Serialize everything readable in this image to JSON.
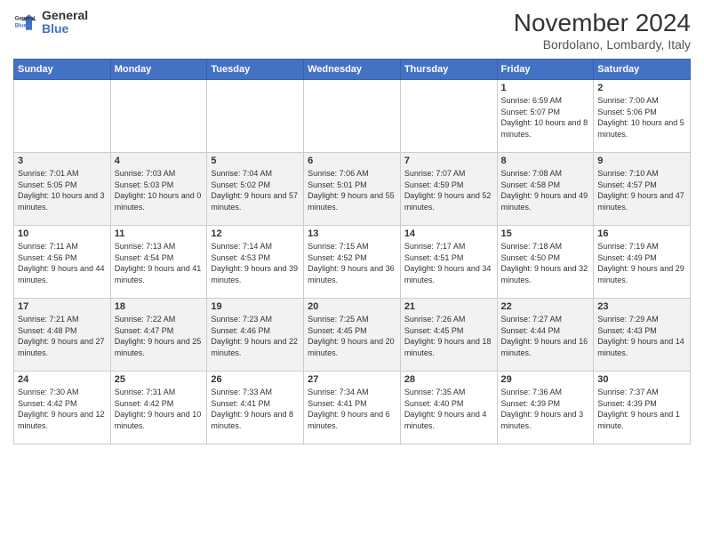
{
  "header": {
    "logo_line1": "General",
    "logo_line2": "Blue",
    "month": "November 2024",
    "location": "Bordolano, Lombardy, Italy"
  },
  "days_of_week": [
    "Sunday",
    "Monday",
    "Tuesday",
    "Wednesday",
    "Thursday",
    "Friday",
    "Saturday"
  ],
  "weeks": [
    [
      {
        "day": "",
        "info": ""
      },
      {
        "day": "",
        "info": ""
      },
      {
        "day": "",
        "info": ""
      },
      {
        "day": "",
        "info": ""
      },
      {
        "day": "",
        "info": ""
      },
      {
        "day": "1",
        "info": "Sunrise: 6:59 AM\nSunset: 5:07 PM\nDaylight: 10 hours and 8 minutes."
      },
      {
        "day": "2",
        "info": "Sunrise: 7:00 AM\nSunset: 5:06 PM\nDaylight: 10 hours and 5 minutes."
      }
    ],
    [
      {
        "day": "3",
        "info": "Sunrise: 7:01 AM\nSunset: 5:05 PM\nDaylight: 10 hours and 3 minutes."
      },
      {
        "day": "4",
        "info": "Sunrise: 7:03 AM\nSunset: 5:03 PM\nDaylight: 10 hours and 0 minutes."
      },
      {
        "day": "5",
        "info": "Sunrise: 7:04 AM\nSunset: 5:02 PM\nDaylight: 9 hours and 57 minutes."
      },
      {
        "day": "6",
        "info": "Sunrise: 7:06 AM\nSunset: 5:01 PM\nDaylight: 9 hours and 55 minutes."
      },
      {
        "day": "7",
        "info": "Sunrise: 7:07 AM\nSunset: 4:59 PM\nDaylight: 9 hours and 52 minutes."
      },
      {
        "day": "8",
        "info": "Sunrise: 7:08 AM\nSunset: 4:58 PM\nDaylight: 9 hours and 49 minutes."
      },
      {
        "day": "9",
        "info": "Sunrise: 7:10 AM\nSunset: 4:57 PM\nDaylight: 9 hours and 47 minutes."
      }
    ],
    [
      {
        "day": "10",
        "info": "Sunrise: 7:11 AM\nSunset: 4:56 PM\nDaylight: 9 hours and 44 minutes."
      },
      {
        "day": "11",
        "info": "Sunrise: 7:13 AM\nSunset: 4:54 PM\nDaylight: 9 hours and 41 minutes."
      },
      {
        "day": "12",
        "info": "Sunrise: 7:14 AM\nSunset: 4:53 PM\nDaylight: 9 hours and 39 minutes."
      },
      {
        "day": "13",
        "info": "Sunrise: 7:15 AM\nSunset: 4:52 PM\nDaylight: 9 hours and 36 minutes."
      },
      {
        "day": "14",
        "info": "Sunrise: 7:17 AM\nSunset: 4:51 PM\nDaylight: 9 hours and 34 minutes."
      },
      {
        "day": "15",
        "info": "Sunrise: 7:18 AM\nSunset: 4:50 PM\nDaylight: 9 hours and 32 minutes."
      },
      {
        "day": "16",
        "info": "Sunrise: 7:19 AM\nSunset: 4:49 PM\nDaylight: 9 hours and 29 minutes."
      }
    ],
    [
      {
        "day": "17",
        "info": "Sunrise: 7:21 AM\nSunset: 4:48 PM\nDaylight: 9 hours and 27 minutes."
      },
      {
        "day": "18",
        "info": "Sunrise: 7:22 AM\nSunset: 4:47 PM\nDaylight: 9 hours and 25 minutes."
      },
      {
        "day": "19",
        "info": "Sunrise: 7:23 AM\nSunset: 4:46 PM\nDaylight: 9 hours and 22 minutes."
      },
      {
        "day": "20",
        "info": "Sunrise: 7:25 AM\nSunset: 4:45 PM\nDaylight: 9 hours and 20 minutes."
      },
      {
        "day": "21",
        "info": "Sunrise: 7:26 AM\nSunset: 4:45 PM\nDaylight: 9 hours and 18 minutes."
      },
      {
        "day": "22",
        "info": "Sunrise: 7:27 AM\nSunset: 4:44 PM\nDaylight: 9 hours and 16 minutes."
      },
      {
        "day": "23",
        "info": "Sunrise: 7:29 AM\nSunset: 4:43 PM\nDaylight: 9 hours and 14 minutes."
      }
    ],
    [
      {
        "day": "24",
        "info": "Sunrise: 7:30 AM\nSunset: 4:42 PM\nDaylight: 9 hours and 12 minutes."
      },
      {
        "day": "25",
        "info": "Sunrise: 7:31 AM\nSunset: 4:42 PM\nDaylight: 9 hours and 10 minutes."
      },
      {
        "day": "26",
        "info": "Sunrise: 7:33 AM\nSunset: 4:41 PM\nDaylight: 9 hours and 8 minutes."
      },
      {
        "day": "27",
        "info": "Sunrise: 7:34 AM\nSunset: 4:41 PM\nDaylight: 9 hours and 6 minutes."
      },
      {
        "day": "28",
        "info": "Sunrise: 7:35 AM\nSunset: 4:40 PM\nDaylight: 9 hours and 4 minutes."
      },
      {
        "day": "29",
        "info": "Sunrise: 7:36 AM\nSunset: 4:39 PM\nDaylight: 9 hours and 3 minutes."
      },
      {
        "day": "30",
        "info": "Sunrise: 7:37 AM\nSunset: 4:39 PM\nDaylight: 9 hours and 1 minute."
      }
    ]
  ]
}
